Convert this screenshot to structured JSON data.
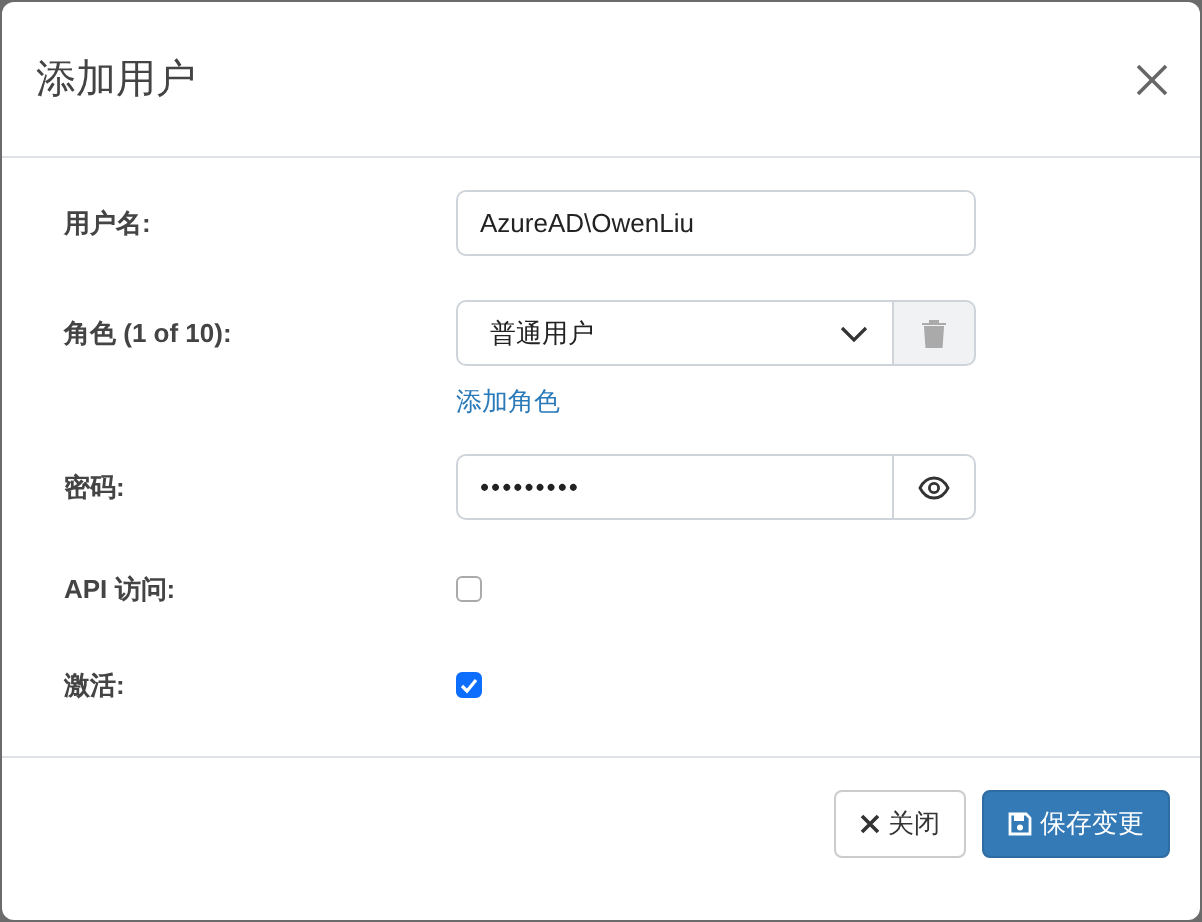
{
  "dialog": {
    "title": "添加用户"
  },
  "fields": [
    {
      "kind": "text",
      "label": "用户名:",
      "value": "AzureAD\\OwenLiu"
    },
    {
      "kind": "select",
      "label": "角色 (1 of 10):",
      "value": "普通用户",
      "link": "添加角色"
    },
    {
      "kind": "password",
      "label": "密码:",
      "value": "•••••••••"
    },
    {
      "kind": "checkbox",
      "label": "API 访问:",
      "checked": false
    },
    {
      "kind": "checkbox",
      "label": "激活:",
      "checked": true
    }
  ],
  "buttons": [
    {
      "kind": "close",
      "label": "关闭"
    },
    {
      "kind": "save",
      "label": "保存变更"
    }
  ]
}
